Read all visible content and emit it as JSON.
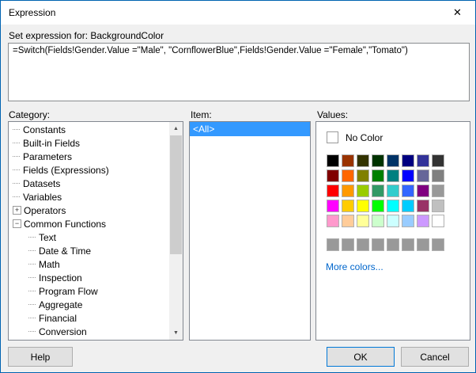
{
  "window": {
    "title": "Expression"
  },
  "icons": {
    "close": "✕",
    "scroll_up": "▲",
    "scroll_down": "▼"
  },
  "expression": {
    "label": "Set expression for: BackgroundColor",
    "value": "=Switch(Fields!Gender.Value =\"Male\", \"CornflowerBlue\",Fields!Gender.Value =\"Female\",\"Tomato\")"
  },
  "category": {
    "label": "Category:",
    "items": [
      {
        "label": "Constants",
        "level": 0,
        "expander": ""
      },
      {
        "label": "Built-in Fields",
        "level": 0,
        "expander": ""
      },
      {
        "label": "Parameters",
        "level": 0,
        "expander": ""
      },
      {
        "label": "Fields (Expressions)",
        "level": 0,
        "expander": ""
      },
      {
        "label": "Datasets",
        "level": 0,
        "expander": ""
      },
      {
        "label": "Variables",
        "level": 0,
        "expander": ""
      },
      {
        "label": "Operators",
        "level": 0,
        "expander": "+"
      },
      {
        "label": "Common Functions",
        "level": 0,
        "expander": "−"
      },
      {
        "label": "Text",
        "level": 1,
        "expander": ""
      },
      {
        "label": "Date & Time",
        "level": 1,
        "expander": ""
      },
      {
        "label": "Math",
        "level": 1,
        "expander": ""
      },
      {
        "label": "Inspection",
        "level": 1,
        "expander": ""
      },
      {
        "label": "Program Flow",
        "level": 1,
        "expander": ""
      },
      {
        "label": "Aggregate",
        "level": 1,
        "expander": ""
      },
      {
        "label": "Financial",
        "level": 1,
        "expander": ""
      },
      {
        "label": "Conversion",
        "level": 1,
        "expander": ""
      }
    ]
  },
  "item": {
    "label": "Item:",
    "items": [
      {
        "label": "<All>",
        "selected": true
      }
    ]
  },
  "values": {
    "label": "Values:",
    "no_color_label": "No Color",
    "more_colors_label": "More colors...",
    "palette": [
      [
        "#000000",
        "#993300",
        "#333300",
        "#003300",
        "#003366",
        "#000080",
        "#333399",
        "#333333"
      ],
      [
        "#800000",
        "#FF6600",
        "#808000",
        "#008000",
        "#008080",
        "#0000FF",
        "#666699",
        "#808080"
      ],
      [
        "#FF0000",
        "#FF9900",
        "#99CC00",
        "#339966",
        "#33CCCC",
        "#3366FF",
        "#800080",
        "#999999"
      ],
      [
        "#FF00FF",
        "#FFCC00",
        "#FFFF00",
        "#00FF00",
        "#00FFFF",
        "#00CCFF",
        "#993366",
        "#C0C0C0"
      ],
      [
        "#FF99CC",
        "#FFCC99",
        "#FFFF99",
        "#CCFFCC",
        "#CCFFFF",
        "#99CCFF",
        "#CC99FF",
        "#FFFFFF"
      ]
    ],
    "gray_row": [
      "#999999",
      "#999999",
      "#999999",
      "#999999",
      "#999999",
      "#999999",
      "#999999",
      "#999999"
    ]
  },
  "buttons": {
    "help": "Help",
    "ok": "OK",
    "cancel": "Cancel"
  },
  "colors": {
    "window_border": "#0063b1",
    "selection": "#3399ff",
    "link": "#0066cc",
    "ok_border": "#0078d7"
  }
}
